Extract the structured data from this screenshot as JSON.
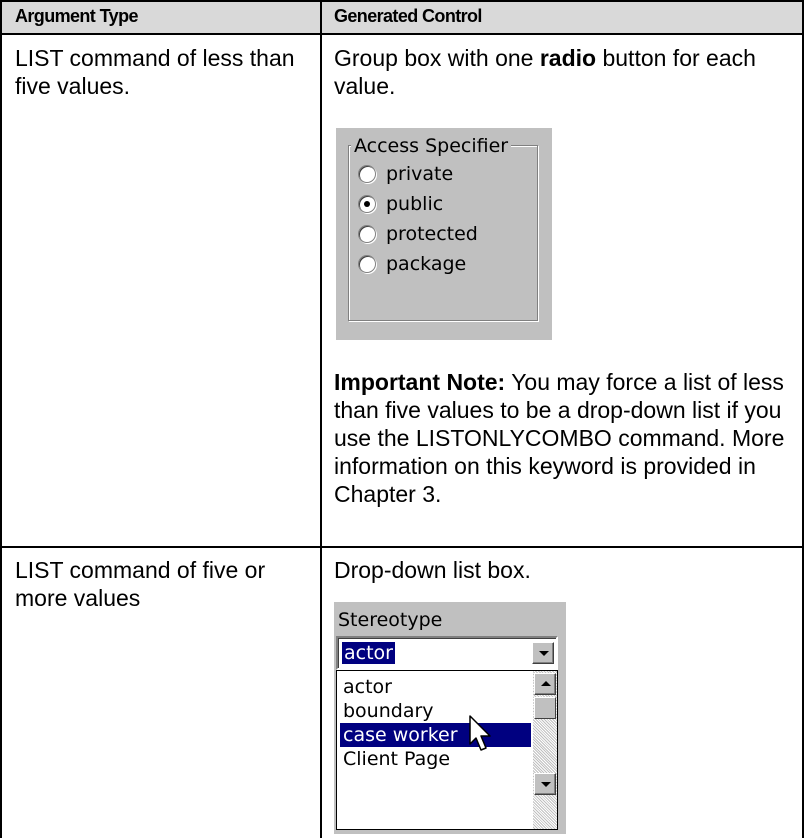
{
  "table": {
    "headers": [
      "Argument Type",
      "Generated Control"
    ],
    "rows": [
      {
        "argument": "LIST command of less than five values.",
        "control_desc_prefix": "Group box with one ",
        "control_desc_bold": "radio",
        "control_desc_suffix": " button for each value.",
        "note_bold": "Important Note:",
        "note_text": " You may force a list of less than five values to be a drop-down list if you use the LISTONLYCOMBO command. More information on this keyword is provided in Chapter 3."
      },
      {
        "argument": "LIST command of five or more values",
        "control_desc": "Drop-down list box."
      }
    ]
  },
  "radio_group": {
    "legend": "Access Specifier",
    "options": [
      {
        "label": "private",
        "selected": false
      },
      {
        "label": "public",
        "selected": true
      },
      {
        "label": "protected",
        "selected": false
      },
      {
        "label": "package",
        "selected": false
      }
    ]
  },
  "combo": {
    "label": "Stereotype",
    "value": "actor",
    "items": [
      {
        "label": "actor",
        "selected": false
      },
      {
        "label": "boundary",
        "selected": false
      },
      {
        "label": "case worker",
        "selected": true
      },
      {
        "label": "Client Page",
        "selected": false
      }
    ]
  },
  "icons": {
    "cursor": "mouse-pointer-icon",
    "dropdown": "chevron-down-icon",
    "scroll_up": "scroll-up-arrow-icon",
    "scroll_down": "scroll-down-arrow-icon"
  },
  "colors": {
    "header_bg": "#d9d9d9",
    "dialog_bg": "#c0c0c0",
    "selection": "#000080"
  }
}
